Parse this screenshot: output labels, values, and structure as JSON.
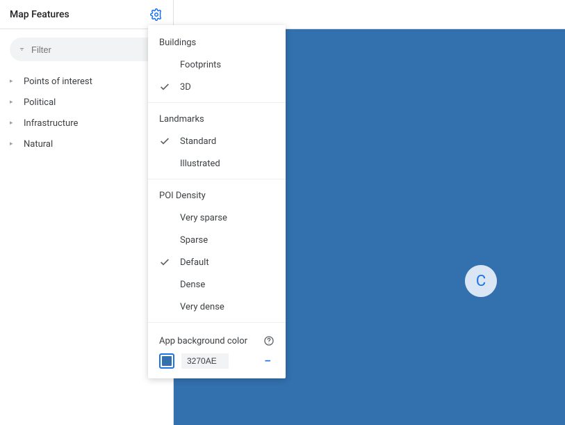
{
  "sidebar": {
    "title": "Map Features",
    "filter_placeholder": "Filter",
    "items": [
      {
        "label": "Points of interest"
      },
      {
        "label": "Political"
      },
      {
        "label": "Infrastructure"
      },
      {
        "label": "Natural"
      }
    ]
  },
  "settings": {
    "sections": [
      {
        "heading": "Buildings",
        "options": [
          {
            "label": "Footprints",
            "selected": false
          },
          {
            "label": "3D",
            "selected": true
          }
        ]
      },
      {
        "heading": "Landmarks",
        "options": [
          {
            "label": "Standard",
            "selected": true
          },
          {
            "label": "Illustrated",
            "selected": false
          }
        ]
      },
      {
        "heading": "POI Density",
        "options": [
          {
            "label": "Very sparse",
            "selected": false
          },
          {
            "label": "Sparse",
            "selected": false
          },
          {
            "label": "Default",
            "selected": true
          },
          {
            "label": "Dense",
            "selected": false
          },
          {
            "label": "Very dense",
            "selected": false
          }
        ]
      }
    ],
    "bg_color": {
      "label": "App background color",
      "hex": "3270AE"
    }
  },
  "map": {
    "badge_letter": "C",
    "background": "#3270AE"
  }
}
